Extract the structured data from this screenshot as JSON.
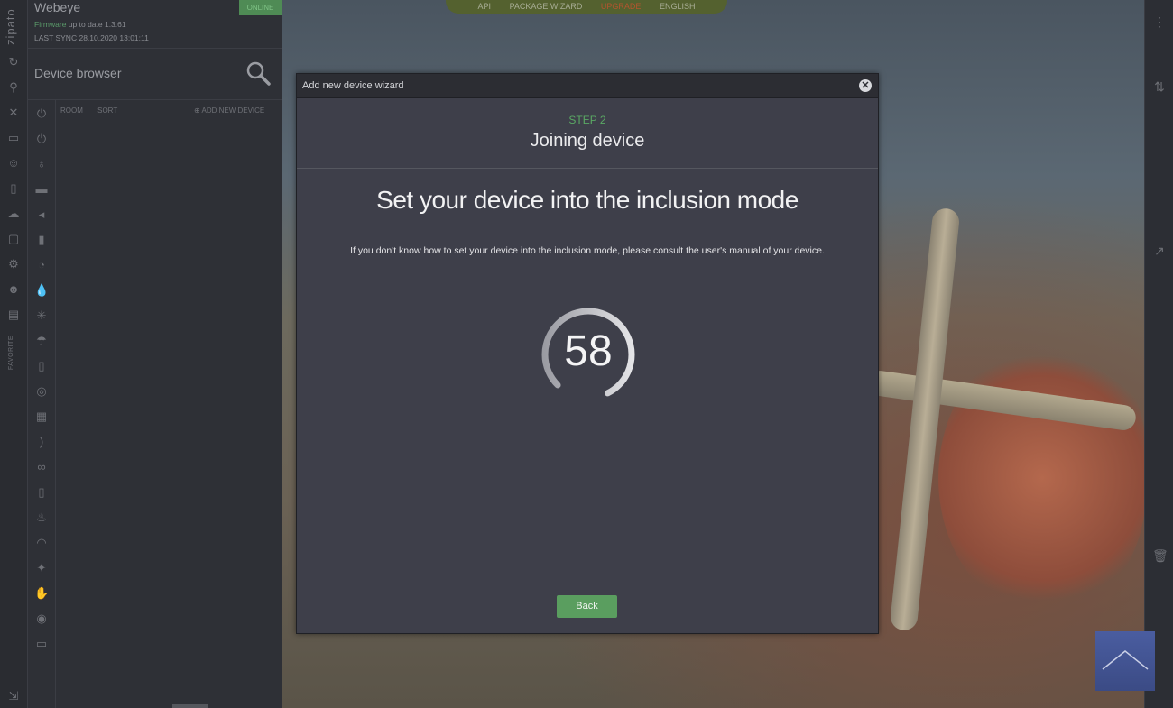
{
  "window": {
    "name": "Webeye",
    "status_badge": "ONLINE",
    "firmware_label": "Firmware",
    "firmware_text": "up to date 1.3.61",
    "last_sync_label": "LAST SYNC",
    "last_sync_value": "28.10.2020 13:01:11",
    "brand": "zipato"
  },
  "top_nav": {
    "items": [
      "API",
      "PACKAGE WIZARD",
      "UPGRADE",
      "ENGLISH"
    ],
    "accent": "#b4542e"
  },
  "device_browser": {
    "title": "Device browser",
    "toolbar": [
      "ROOM",
      "SORT"
    ],
    "add_new_label": "ADD NEW DEVICE",
    "favorite_label": "FAVORITE"
  },
  "modal": {
    "title": "Add new device wizard",
    "step_label": "STEP 2",
    "step_title": "Joining device",
    "main_title": "Set your device into the inclusion mode",
    "description": "If you don't know how to set your device into the inclusion mode, please consult the user's manual of your device.",
    "countdown_value": "58",
    "countdown_fraction": 0.8,
    "back_label": "Back",
    "accent_color": "#5a9e5f"
  }
}
